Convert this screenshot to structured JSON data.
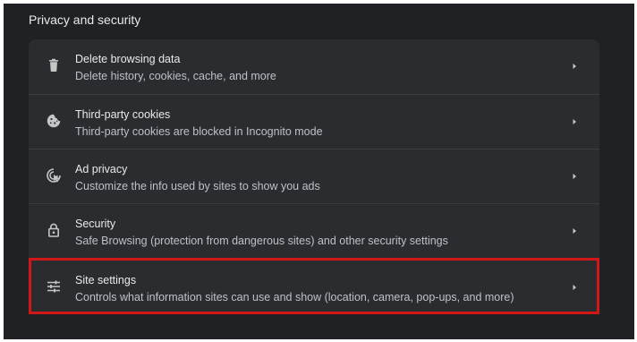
{
  "section": {
    "title": "Privacy and security"
  },
  "items": [
    {
      "title": "Delete browsing data",
      "subtitle": "Delete history, cookies, cache, and more",
      "icon": "trash-icon"
    },
    {
      "title": "Third-party cookies",
      "subtitle": "Third-party cookies are blocked in Incognito mode",
      "icon": "cookie-icon"
    },
    {
      "title": "Ad privacy",
      "subtitle": "Customize the info used by sites to show you ads",
      "icon": "ad-privacy-icon"
    },
    {
      "title": "Security",
      "subtitle": "Safe Browsing (protection from dangerous sites) and other security settings",
      "icon": "lock-icon"
    },
    {
      "title": "Site settings",
      "subtitle": "Controls what information sites can use and show (location, camera, pop-ups, and more)",
      "icon": "tune-icon"
    }
  ],
  "colors": {
    "background": "#202124",
    "card": "#2b2c2f",
    "text_primary": "#e8eaed",
    "text_secondary": "#bdc1c6",
    "highlight": "#d11717"
  },
  "highlighted_item": "Site settings"
}
